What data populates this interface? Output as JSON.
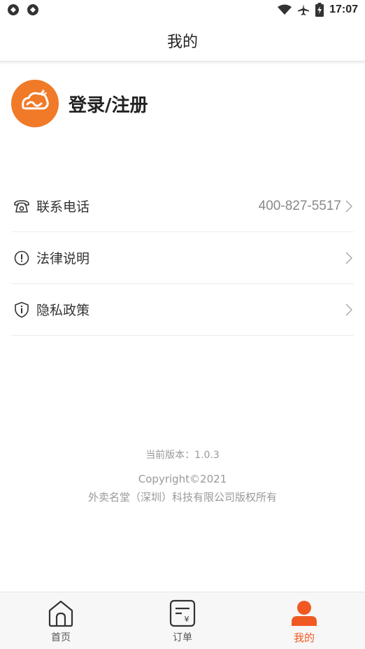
{
  "status_bar": {
    "time": "17:07",
    "left_icons": [
      "notification-icon",
      "notification-icon"
    ],
    "right_icons": [
      "wifi-icon",
      "airplane-icon",
      "battery-icon"
    ]
  },
  "header": {
    "title": "我的"
  },
  "profile": {
    "login_label": "登录/注册",
    "avatar_icon": "bread-logo-icon"
  },
  "menu": {
    "items": [
      {
        "icon": "phone-icon",
        "label": "联系电话",
        "value": "400-827-5517"
      },
      {
        "icon": "info-icon",
        "label": "法律说明",
        "value": ""
      },
      {
        "icon": "shield-icon",
        "label": "隐私政策",
        "value": ""
      }
    ]
  },
  "footer": {
    "version": "当前版本：1.0.3",
    "copyright": "Copyright©2021",
    "company": "外卖名堂（深圳）科技有限公司版权所有"
  },
  "bottom_nav": {
    "tabs": [
      {
        "label": "首页",
        "icon": "home-icon",
        "active": false
      },
      {
        "label": "订单",
        "icon": "order-icon",
        "active": false
      },
      {
        "label": "我的",
        "icon": "user-icon",
        "active": true
      }
    ]
  },
  "colors": {
    "accent": "#F05A22",
    "avatar_bg": "#F07A28",
    "text": "#333333",
    "muted": "#999999"
  }
}
